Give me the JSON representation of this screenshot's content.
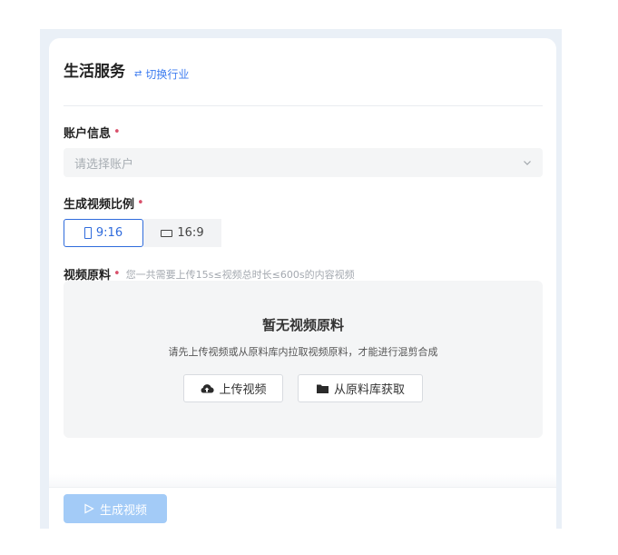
{
  "header": {
    "title": "生活服务",
    "switch_label": "切换行业"
  },
  "account": {
    "label": "账户信息",
    "required_mark": "•",
    "placeholder": "请选择账户"
  },
  "ratio": {
    "label": "生成视频比例",
    "required_mark": "•",
    "options": [
      {
        "label": "9:16",
        "selected": true
      },
      {
        "label": "16:9",
        "selected": false
      }
    ]
  },
  "material": {
    "label": "视频原料",
    "required_mark": "•",
    "hint": "您一共需要上传15s≤视频总时长≤600s的内容视频",
    "empty_title": "暂无视频原料",
    "empty_desc": "请先上传视频或从原料库内拉取视频原料，才能进行混剪合成",
    "upload_label": "上传视频",
    "library_label": "从原料库获取"
  },
  "footer": {
    "generate_label": "生成视频"
  },
  "colors": {
    "accent": "#2f6bdc",
    "link": "#3d7cf0",
    "required": "#d9506b",
    "disabled_button": "#a3cbf7"
  },
  "icons": {
    "switch": "swap-arrows-icon",
    "dropdown": "chevron-down-icon",
    "portrait": "portrait-frame-icon",
    "landscape": "landscape-frame-icon",
    "upload": "cloud-upload-icon",
    "library": "folder-icon",
    "generate": "play-triangle-icon"
  }
}
